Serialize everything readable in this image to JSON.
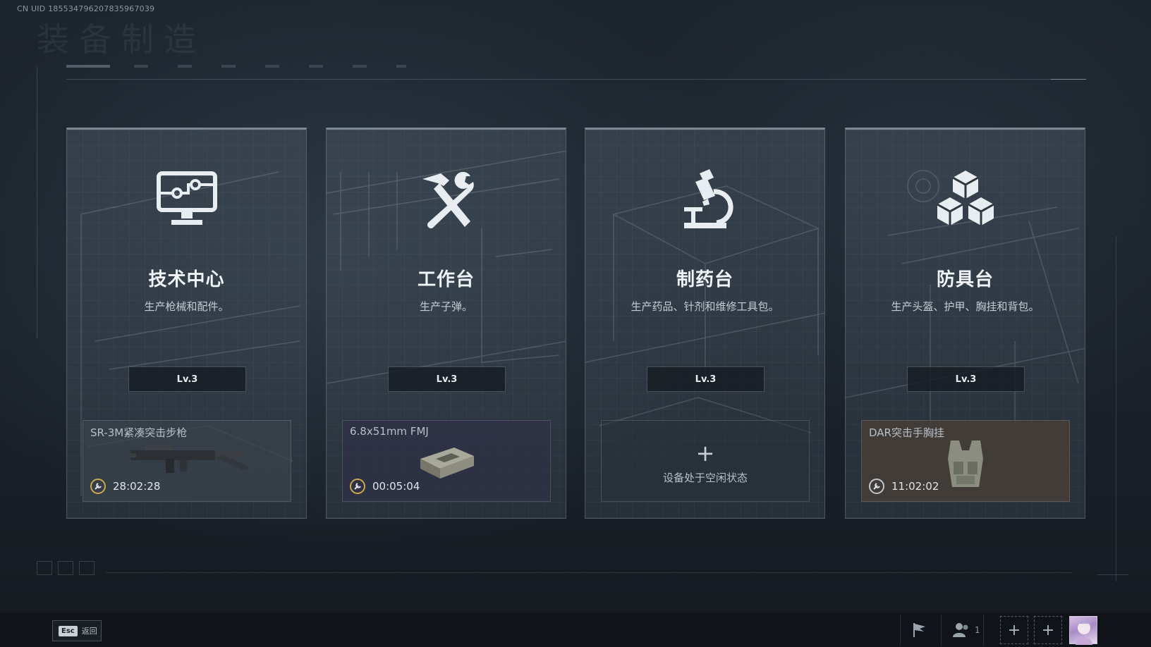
{
  "header": {
    "uid_text": "CN UID 185534796207835967039",
    "ghost_title": "装备制造"
  },
  "stations": [
    {
      "id": "tech",
      "icon": "computer-monitor-icon",
      "title": "技术中心",
      "description": "生产枪械和配件。",
      "level": "Lv.3",
      "slot": {
        "state": "producing",
        "item_name": "SR-3M紧凑突击步枪",
        "item_icon": "rifle-icon",
        "timer": "28:02:28",
        "tint": "#3a434c"
      }
    },
    {
      "id": "workbench",
      "icon": "hammer-wrench-icon",
      "title": "工作台",
      "description": "生产子弹。",
      "level": "Lv.3",
      "slot": {
        "state": "producing",
        "item_name": "6.8x51mm FMJ",
        "item_icon": "ammo-box-icon",
        "timer": "00:05:04",
        "tint": "#2f3146"
      }
    },
    {
      "id": "pharmacy",
      "icon": "microscope-icon",
      "title": "制药台",
      "description": "生产药品、针剂和维修工具包。",
      "level": "Lv.3",
      "slot": {
        "state": "idle",
        "plus": "+",
        "idle_text": "设备处于空闲状态"
      }
    },
    {
      "id": "armor",
      "icon": "boxes-icon",
      "title": "防具台",
      "description": "生产头盔、护甲、胸挂和背包。",
      "level": "Lv.3",
      "slot": {
        "state": "producing",
        "item_name": "DAR突击手胸挂",
        "item_icon": "chest-rig-icon",
        "timer": "11:02:02",
        "tint": "#463e38"
      }
    }
  ],
  "bottom_bar": {
    "esc_key": "Esc",
    "back_label": "返回",
    "team_count": "1",
    "plus_1": "+",
    "plus_2": "+"
  }
}
